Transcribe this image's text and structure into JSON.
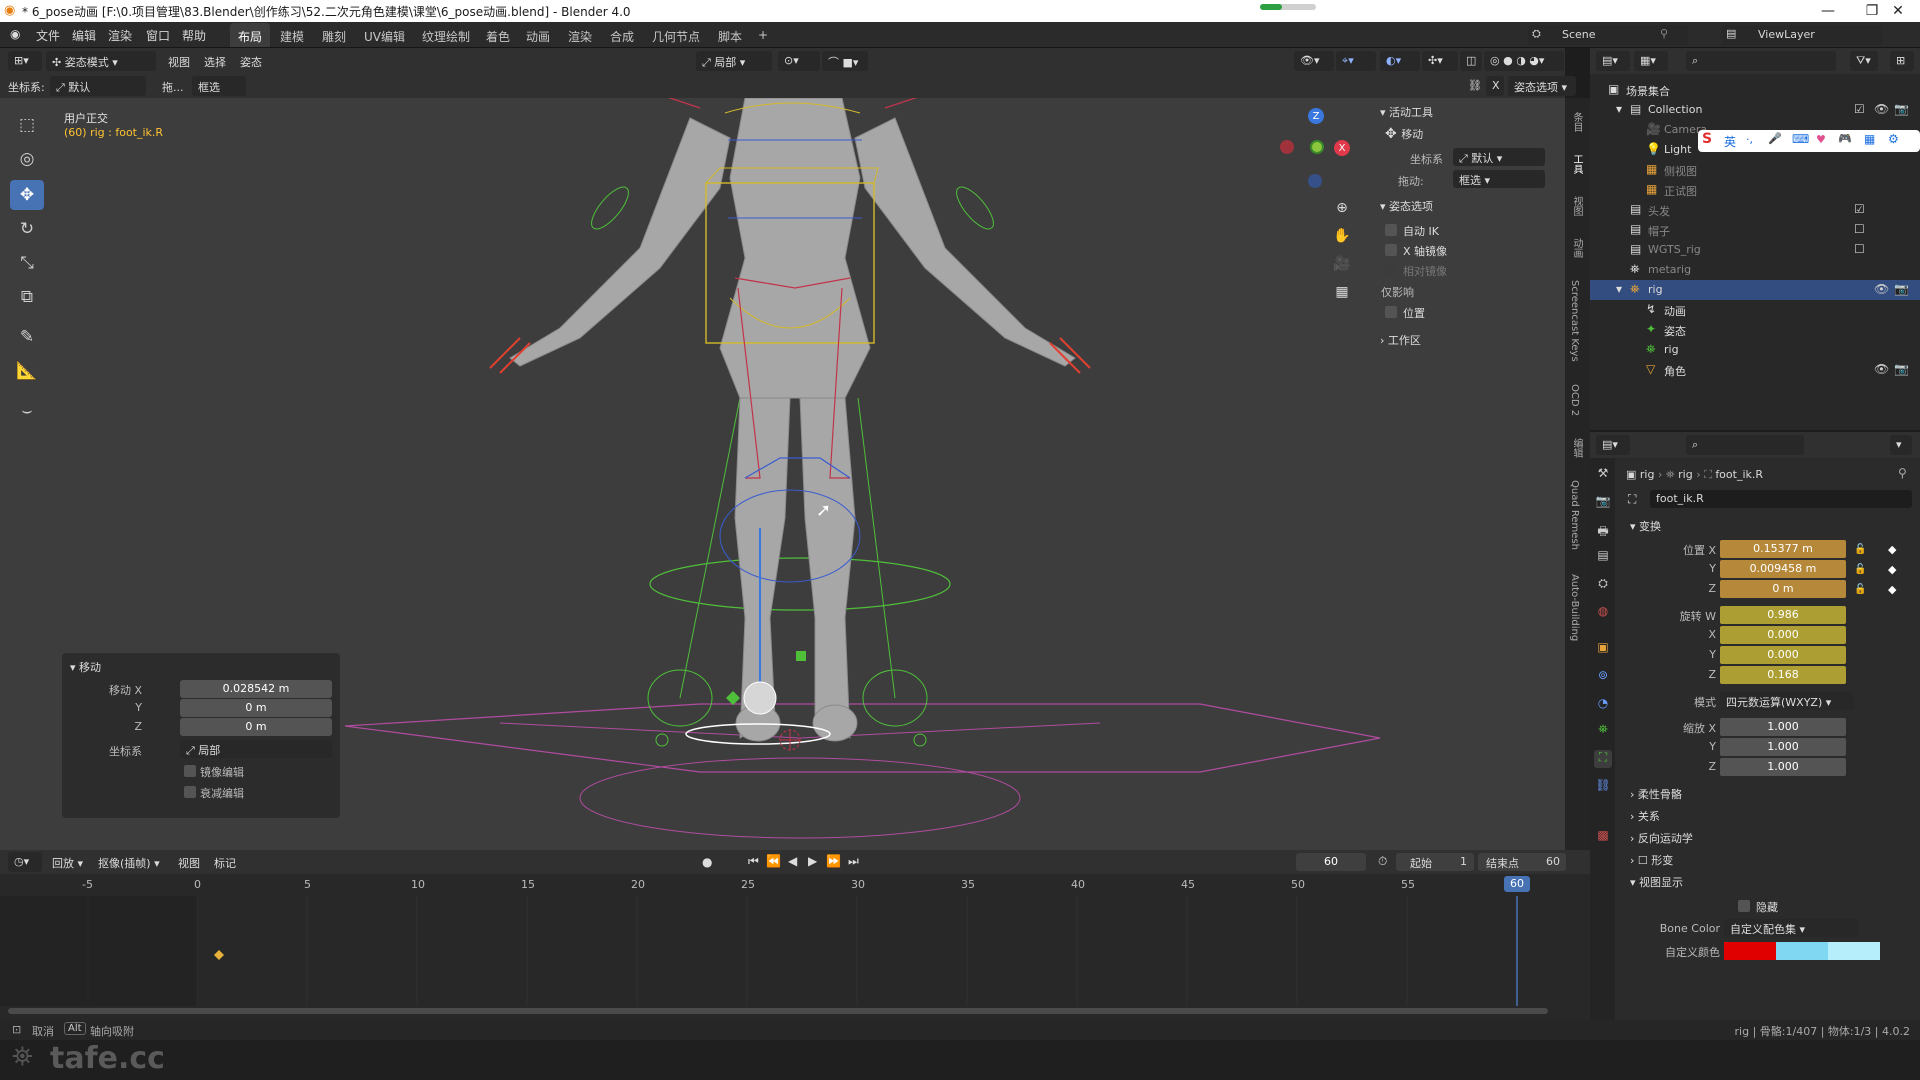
{
  "titlebar": {
    "title": "* 6_pose动画 [F:\\0.项目管理\\83.Blender\\创作练习\\52.二次元角色建模\\课堂\\6_pose动画.blend] - Blender 4.0",
    "minimize": "—",
    "maximize": "❐",
    "close": "✕"
  },
  "menu": [
    "文件",
    "编辑",
    "渲染",
    "窗口",
    "帮助"
  ],
  "workspaces": [
    "布局",
    "建模",
    "雕刻",
    "UV编辑",
    "纹理绘制",
    "着色",
    "动画",
    "渲染",
    "合成",
    "几何节点",
    "脚本"
  ],
  "workspace_add": "+",
  "scene": {
    "label": "Scene",
    "view_layer": "ViewLayer"
  },
  "viewport_header": {
    "mode": "姿态模式",
    "menus": [
      "视图",
      "选择",
      "姿态"
    ],
    "transform_orient": "局部",
    "coord_label": "坐标系:",
    "coord_value": "默认",
    "drag_label": "拖...",
    "drag_value": "框选",
    "pose_options": "姿态选项",
    "x_label": "X"
  },
  "viewport_info": {
    "view_name": "用户正交",
    "object_info": "(60) rig : foot_ik.R"
  },
  "gizmo": {
    "z": "Z",
    "x": "X"
  },
  "npanel": {
    "active_tool_header": "活动工具",
    "tool_name": "移动",
    "coord_label": "坐标系",
    "coord_value": "默认",
    "drag_label": "拖动:",
    "drag_value": "框选",
    "pose_options_header": "姿态选项",
    "auto_ik": "自动 IK",
    "x_mirror": "X 轴镜像",
    "relative_mirror": "相对镜像",
    "affect_only": "仅影响",
    "position": "位置",
    "workspace": "工作区"
  },
  "vertical_tabs": [
    "条目",
    "工具",
    "视图",
    "动画",
    "Screencast Keys",
    "OCD 2",
    "编辑",
    "Quad Remesh",
    "Auto-Building"
  ],
  "redo_panel": {
    "title": "移动",
    "move_x_label": "移动 X",
    "move_x": "0.028542 m",
    "y_label": "Y",
    "y": "0 m",
    "z_label": "Z",
    "z": "0 m",
    "orient_label": "坐标系",
    "orient_value": "局部",
    "mirror": "镜像编辑",
    "proportional": "衰减编辑"
  },
  "outliner": {
    "search_placeholder": "",
    "rows": [
      {
        "label": "场景集合",
        "icon": "▣"
      },
      {
        "label": "Collection",
        "icon": "▤"
      },
      {
        "label": "Camera",
        "icon": "◉"
      },
      {
        "label": "Light",
        "icon": "☀"
      },
      {
        "label": "侧视图",
        "icon": "▦"
      },
      {
        "label": "正试图",
        "icon": "▦"
      },
      {
        "label": "头发",
        "icon": "⁂"
      },
      {
        "label": "帽子",
        "icon": "▤"
      },
      {
        "label": "WGTS_rig",
        "icon": "▤"
      },
      {
        "label": "metarig",
        "icon": "⛯"
      },
      {
        "label": "rig",
        "icon": "⛯"
      },
      {
        "label": "动画",
        "icon": "↯"
      },
      {
        "label": "姿态",
        "icon": "✦"
      },
      {
        "label": "rig",
        "icon": "⛯"
      },
      {
        "label": "角色",
        "icon": "▽"
      }
    ],
    "ime_toolbar": [
      "S",
      "英",
      "·,",
      "🎤",
      "⌨",
      "♥",
      "🎮",
      "▦",
      "⚙"
    ]
  },
  "properties": {
    "breadcrumb": [
      "rig",
      "rig",
      "foot_ik.R"
    ],
    "bone_name": "foot_ik.R",
    "transform_header": "变换",
    "location_label": "位置 X",
    "location_x": "0.15377 m",
    "loc_y_label": "Y",
    "location_y": "0.009458 m",
    "loc_z_label": "Z",
    "location_z": "0 m",
    "rotation_label": "旋转 W",
    "rot_w": "0.986",
    "rot_x_label": "X",
    "rot_x": "0.000",
    "rot_y_label": "Y",
    "rot_y": "0.000",
    "rot_z_label": "Z",
    "rot_z": "0.168",
    "mode_label": "模式",
    "mode_value": "四元数运算(WXYZ)",
    "scale_label": "缩放 X",
    "scale_x": "1.000",
    "scale_y_label": "Y",
    "scale_y": "1.000",
    "scale_z_label": "Z",
    "scale_z": "1.000",
    "sections": [
      "柔性骨骼",
      "关系",
      "反向运动学",
      "形变"
    ],
    "viewport_display": "视图显示",
    "hide_label": "隐藏",
    "bone_color_label": "Bone Color",
    "bone_color_value": "自定义配色集",
    "custom_color_label": "自定义颜色",
    "custom_colors": [
      "#e00000",
      "#7fd7f2",
      "#b6eefc"
    ]
  },
  "timeline": {
    "menus": [
      "回放",
      "抠像(插帧)",
      "视图",
      "标记"
    ],
    "current_frame": "60",
    "start_label": "起始",
    "start": "1",
    "end_label": "结束点",
    "end": "60",
    "ticks": [
      "-5",
      "0",
      "5",
      "10",
      "15",
      "20",
      "25",
      "30",
      "35",
      "40",
      "45",
      "50",
      "55",
      "60"
    ],
    "playhead": "60"
  },
  "statusbar": {
    "left_hint": "取消",
    "alt_key": "Alt",
    "snap_hint": "轴向吸附",
    "right": "rig | 骨骼:1/407 | 物体:1/3 | 4.0.2"
  },
  "watermark": "tafe.cc",
  "colors": {
    "accent": "#4772b3",
    "selected_row": "#334d80",
    "animated": "#b6893a",
    "keyed": "#ad9e33"
  }
}
